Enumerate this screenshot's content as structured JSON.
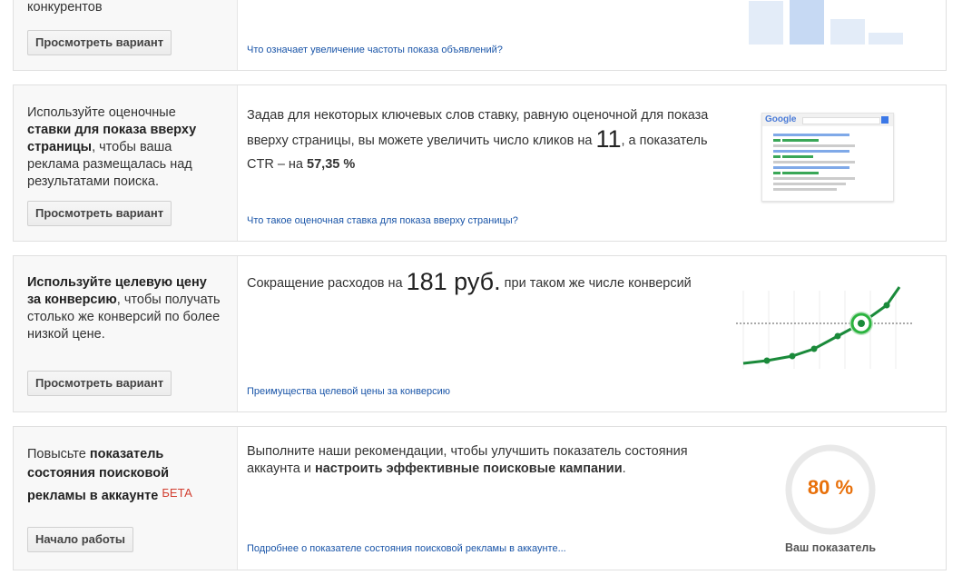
{
  "cards": [
    {
      "left_text": "конкурентов",
      "button": "Просмотреть вариант",
      "link": "Что означает увеличение частоты показа объявлений?"
    },
    {
      "left_parts": [
        "Используйте оценочные ",
        "ставки для показа вверху страницы",
        ", чтобы ваша реклама размещалась над результатами поиска."
      ],
      "button": "Просмотреть вариант",
      "mid_parts": [
        "Задав для некоторых ключевых слов ставку, равную оценочной для показа вверху страницы, вы можете увеличить число кликов на ",
        "11",
        ", а показатель CTR – на ",
        "57,35 %"
      ],
      "link": "Что такое оценочная ставка для показа вверху страницы?",
      "google_logo": "Google"
    },
    {
      "left_parts": [
        "Используйте целевую цену за конверсию",
        ", чтобы получать столько же конверсий по более низкой цене."
      ],
      "button": "Просмотреть вариант",
      "mid_parts": [
        "Сокращение расходов на ",
        "181 руб.",
        " при таком же числе конверсий"
      ],
      "link": "Преимущества целевой цены за конверсию"
    },
    {
      "left_parts": [
        "Повысьте ",
        "показатель состояния поисковой рекламы в аккаунте",
        "БЕТА"
      ],
      "button": "Начало работы",
      "mid_parts": [
        "Выполните наши рекомендации, чтобы улучшить показатель состояния аккаунта и ",
        "настроить эффективные поисковые кампании",
        "."
      ],
      "link": "Подробнее о показателе состояния поисковой рекламы в аккаунте...",
      "score_value": "80 %",
      "score_fraction": 0.8,
      "score_label": "Ваш показатель"
    }
  ],
  "colors": {
    "link": "#1a55a8",
    "accent_green": "#1a9641",
    "score_orange": "#e8700a",
    "beta_red": "#d23f31"
  }
}
